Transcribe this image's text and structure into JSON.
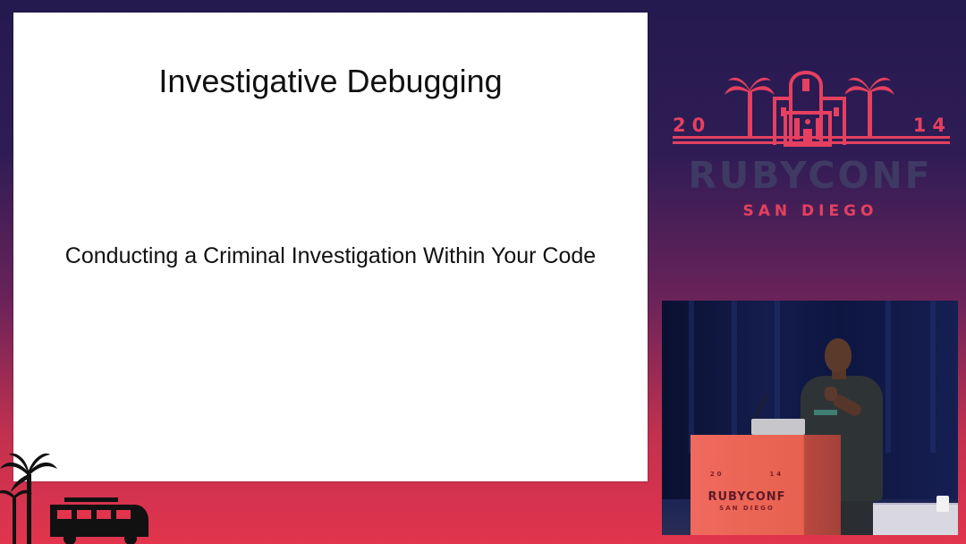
{
  "slide": {
    "title": "Investigative Debugging",
    "subtitle": "Conducting a Criminal Investigation Within Your Code"
  },
  "logo": {
    "year_left": "20",
    "year_right": "14",
    "name": "RUBYCONF",
    "city": "SAN DIEGO"
  },
  "podium": {
    "year_left": "20",
    "year_right": "14",
    "name": "RUBYCONF",
    "city": "SAN DIEGO"
  },
  "colors": {
    "accent": "#e5405f",
    "logo_text": "#3e3a63",
    "background_top": "#241a4f",
    "background_bottom": "#e2344d"
  }
}
